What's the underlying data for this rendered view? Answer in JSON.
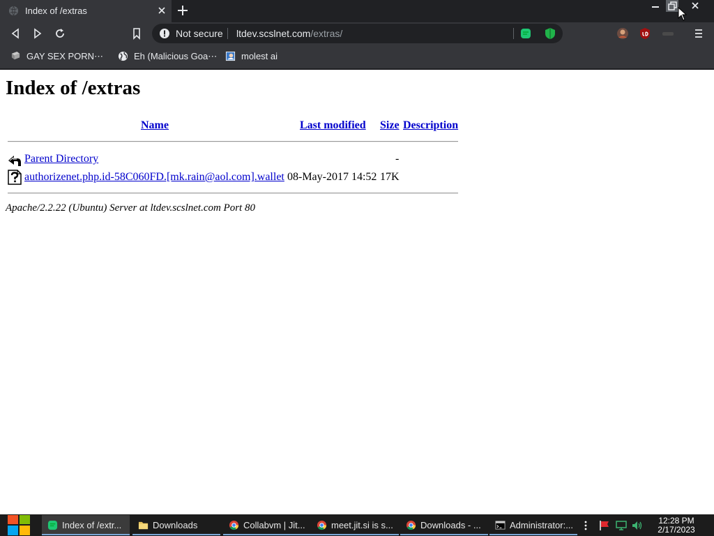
{
  "browser": {
    "tab": {
      "title": "Index of /extras"
    },
    "omnibox": {
      "security_label": "Not secure",
      "url_host": "ltdev.scslnet.com",
      "url_path": "/extras/"
    },
    "bookmarks": [
      {
        "label": "GAY SEX PORN⋯",
        "icon": "monitor-icon"
      },
      {
        "label": "Eh (Malicious Goa⋯",
        "icon": "globe-icon"
      },
      {
        "label": "molest ai",
        "icon": "image-icon"
      }
    ]
  },
  "page": {
    "heading": "Index of /extras",
    "columns": {
      "name": "Name",
      "modified": "Last modified",
      "size": "Size",
      "description": "Description"
    },
    "rows": [
      {
        "name": "Parent Directory",
        "modified": "",
        "size": "-",
        "icon": "back-arrow-icon"
      },
      {
        "name": "authorizenet.php.id-58C060FD.[mk.rain@aol.com].wallet",
        "modified": "08-May-2017 14:52",
        "size": "17K",
        "icon": "unknown-file-icon"
      }
    ],
    "address": "Apache/2.2.22 (Ubuntu) Server at ltdev.scslnet.com Port 80"
  },
  "taskbar": {
    "tasks": [
      {
        "label": "Index of /extr...",
        "icon": "chrome-green-icon",
        "active": true
      },
      {
        "label": "Downloads",
        "icon": "folder-icon",
        "active": false
      },
      {
        "label": "Collabvm | Jit...",
        "icon": "chrome-icon",
        "active": false
      },
      {
        "label": "meet.jit.si is s...",
        "icon": "chrome-icon",
        "active": false
      },
      {
        "label": "Downloads - ...",
        "icon": "chrome-icon",
        "active": false
      },
      {
        "label": "Administrator:...",
        "icon": "cmd-icon",
        "active": false
      }
    ],
    "clock": {
      "time": "12:28 PM",
      "date": "2/17/2023"
    }
  },
  "colors": {
    "chrome_dark": "#202124",
    "chrome_toolbar": "#35363a",
    "link": "#0000cc",
    "taskbar": "#1c1c1c"
  }
}
